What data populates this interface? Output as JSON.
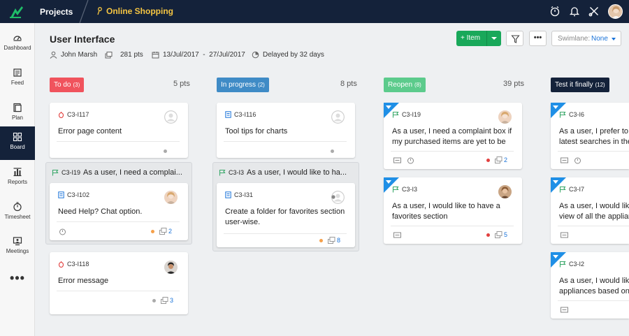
{
  "header": {
    "projects_label": "Projects",
    "project_name": "Online Shopping"
  },
  "sidebar": {
    "items": [
      {
        "label": "Dashboard",
        "icon": "dashboard-icon"
      },
      {
        "label": "Feed",
        "icon": "feed-icon"
      },
      {
        "label": "Plan",
        "icon": "plan-icon"
      },
      {
        "label": "Board",
        "icon": "board-icon"
      },
      {
        "label": "Reports",
        "icon": "reports-icon"
      },
      {
        "label": "Timesheet",
        "icon": "timesheet-icon"
      },
      {
        "label": "Meetings",
        "icon": "meetings-icon"
      }
    ],
    "more": "•••"
  },
  "page": {
    "title": "User Interface",
    "owner": "John Marsh",
    "points": "281 pts",
    "dates": "13/Jul/2017  -  27/Jul/2017",
    "delay": "Delayed by 32 days"
  },
  "toolbar": {
    "add_label": "+ Item",
    "more": "•••",
    "swimlane_label": "Swimlane:",
    "swimlane_value": "None"
  },
  "columns": [
    {
      "name": "To do",
      "count": "(3)",
      "points": "5 pts",
      "color": "#f0535d"
    },
    {
      "name": "In progress",
      "count": "(2)",
      "points": "8 pts",
      "color": "#3f8bc6"
    },
    {
      "name": "Reopen",
      "count": "(8)",
      "points": "39 pts",
      "color": "#5ccb8c"
    },
    {
      "name": "Test it finally",
      "count": "(12)",
      "points": "",
      "color": "#14223a"
    }
  ],
  "cards": {
    "c1": {
      "id": "C3-I117",
      "title": "Error page content"
    },
    "g1": {
      "id": "C3-I19",
      "title": "As a user, I need a complai..."
    },
    "c2": {
      "id": "C3-I102",
      "title": "Need Help? Chat option.",
      "count": "2"
    },
    "c3": {
      "id": "C3-I118",
      "title": "Error message",
      "count": "3"
    },
    "c4": {
      "id": "C3-I116",
      "title": "Tool tips for charts"
    },
    "g2": {
      "id": "C3-I3",
      "title": "As a user, I would like to ha..."
    },
    "c5": {
      "id": "C3-I31",
      "line1": "Create a folder for favorites section",
      "line2": "user-wise.",
      "count": "8"
    },
    "c6": {
      "id": "C3-I19",
      "line1": "As a user, I need a complaint box if",
      "line2": "my purchased items are yet to be",
      "count": "2"
    },
    "c7": {
      "id": "C3-I3",
      "line1": "As a user, I would like to have a",
      "line2": "favorites section",
      "count": "5"
    },
    "c8": {
      "id": "C3-I6",
      "line1": "As a user, I prefer to li",
      "line2": "latest searches in the"
    },
    "c9": {
      "id": "C3-I7",
      "line1": "As a user, I would like",
      "line2": "view of all the applian"
    },
    "c10": {
      "id": "C3-I2",
      "line1": "As a user, I would like",
      "line2": "appliances based on t"
    }
  },
  "colors": {
    "accent_green": "#19a85a",
    "nav_dark": "#14223a",
    "link_blue": "#1a73d9",
    "bug_red": "#e2403f"
  }
}
